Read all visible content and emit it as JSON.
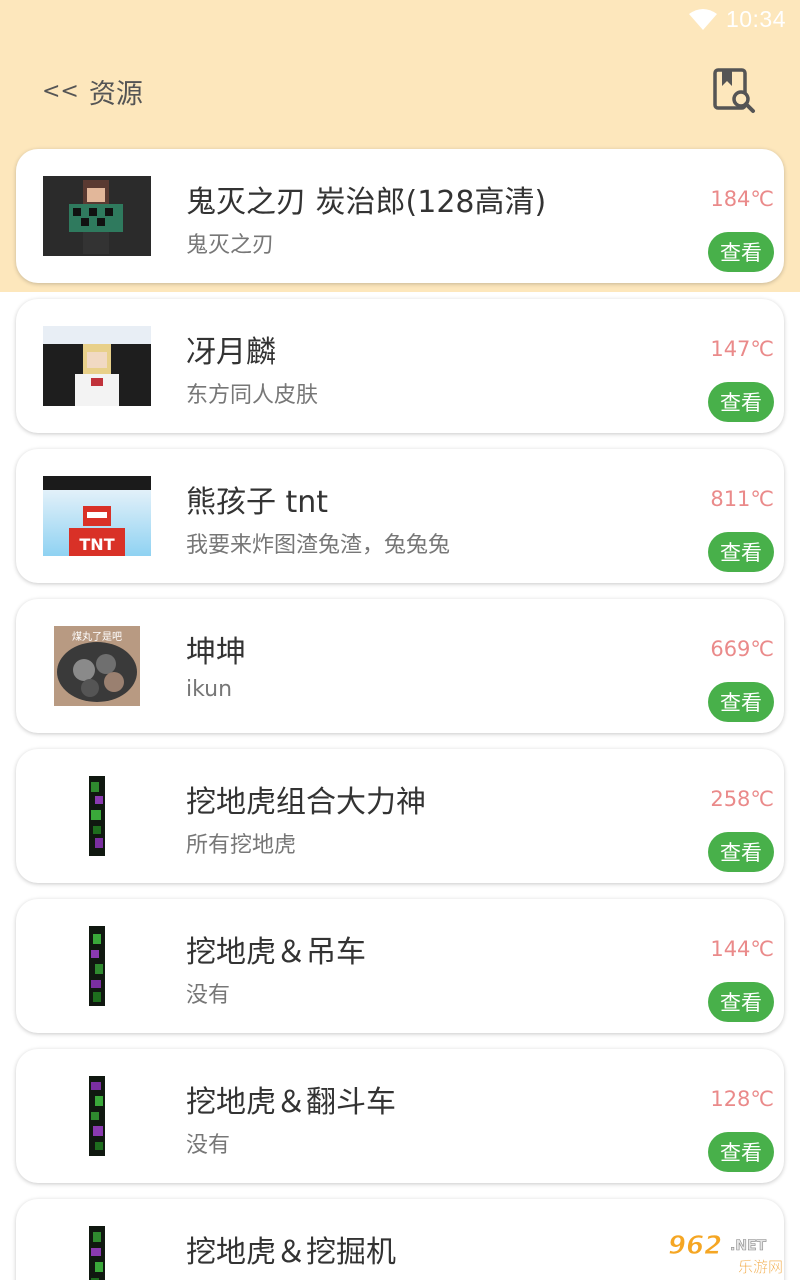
{
  "status_bar": {
    "time": "10:34"
  },
  "header": {
    "back_arrows": "<<",
    "title": "资源"
  },
  "items": [
    {
      "title": "鬼灭之刃 炭治郎(128高清)",
      "subtitle": "鬼灭之刃",
      "heat": "184℃",
      "view_label": "查看"
    },
    {
      "title": "冴月麟",
      "subtitle": "东方同人皮肤",
      "heat": "147℃",
      "view_label": "查看"
    },
    {
      "title": "熊孩子 tnt",
      "subtitle": "我要来炸图渣兔渣，兔兔兔",
      "heat": "811℃",
      "view_label": "查看",
      "thumb_text": "TNT"
    },
    {
      "title": "坤坤",
      "subtitle": "ikun",
      "heat": "669℃",
      "view_label": "查看",
      "thumb_text": "煤丸了是吧"
    },
    {
      "title": "挖地虎组合大力神",
      "subtitle": "所有挖地虎",
      "heat": "258℃",
      "view_label": "查看"
    },
    {
      "title": "挖地虎＆吊车",
      "subtitle": "没有",
      "heat": "144℃",
      "view_label": "查看"
    },
    {
      "title": "挖地虎＆翻斗车",
      "subtitle": "没有",
      "heat": "128℃",
      "view_label": "查看"
    },
    {
      "title": "挖地虎＆挖掘机",
      "subtitle": "",
      "heat": "",
      "view_label": ""
    }
  ],
  "watermark": {
    "number": "962",
    "suffix": ".NET",
    "caption": "乐游网"
  }
}
